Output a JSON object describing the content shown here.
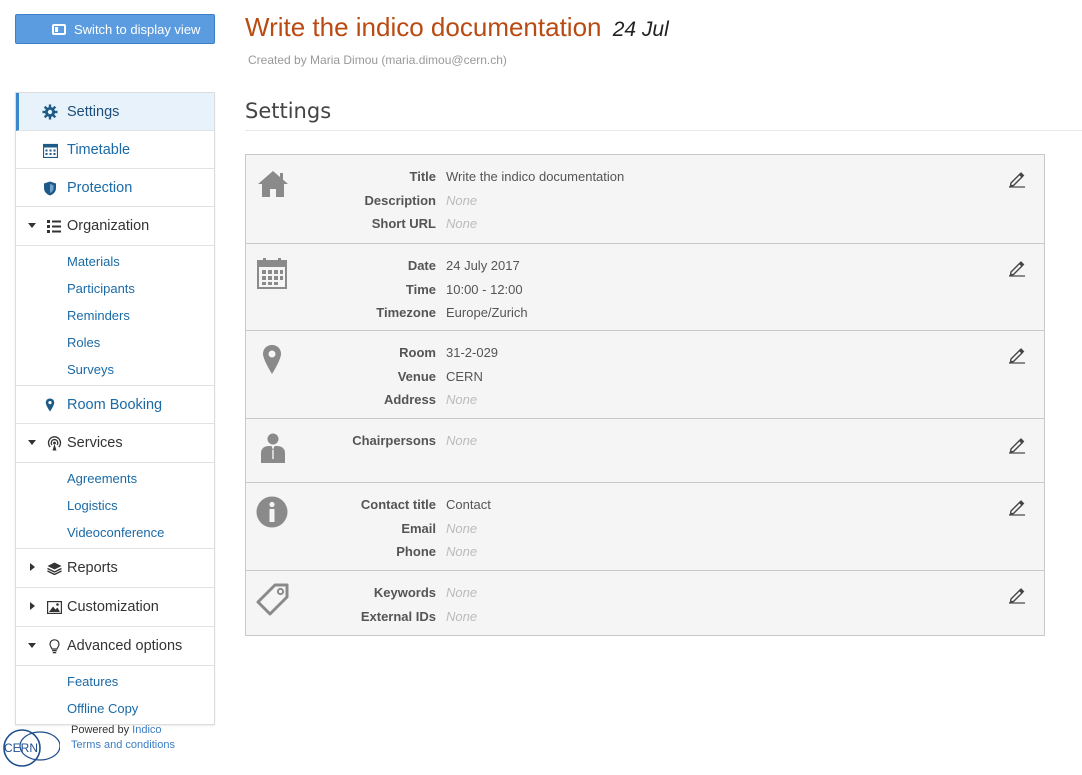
{
  "header": {
    "switch_button_label": "Switch to display view",
    "event_title": "Write the indico documentation",
    "event_date": "24 Jul",
    "created_by": "Created by Maria Dimou (maria.dimou@cern.ch)"
  },
  "sidebar": {
    "top_items": [
      {
        "label": "Settings",
        "icon": "gear-icon",
        "active": true
      },
      {
        "label": "Timetable",
        "icon": "calendar-icon"
      },
      {
        "label": "Protection",
        "icon": "shield-icon"
      }
    ],
    "organization": {
      "label": "Organization",
      "icon": "list-icon",
      "items": [
        "Materials",
        "Participants",
        "Reminders",
        "Roles",
        "Surveys"
      ]
    },
    "room_booking": {
      "label": "Room Booking",
      "icon": "map-pin-icon"
    },
    "services": {
      "label": "Services",
      "icon": "broadcast-icon",
      "items": [
        "Agreements",
        "Logistics",
        "Videoconference"
      ]
    },
    "reports": {
      "label": "Reports",
      "icon": "layers-icon"
    },
    "customization": {
      "label": "Customization",
      "icon": "image-icon"
    },
    "advanced": {
      "label": "Advanced options",
      "icon": "lightbulb-icon",
      "items": [
        "Features",
        "Offline Copy"
      ]
    }
  },
  "footer": {
    "powered_prefix": "Powered by",
    "powered_link": "Indico",
    "terms": "Terms and conditions",
    "logo_text": "CERN"
  },
  "main": {
    "section_title": "Settings",
    "groups": [
      {
        "icon": "home-icon",
        "rows": [
          {
            "key": "Title",
            "value": "Write the indico documentation",
            "none": false
          },
          {
            "key": "Description",
            "value": "None",
            "none": true
          },
          {
            "key": "Short URL",
            "value": "None",
            "none": true
          }
        ]
      },
      {
        "icon": "calendar-icon",
        "rows": [
          {
            "key": "Date",
            "value": "24 July 2017",
            "none": false
          },
          {
            "key": "Time",
            "value": "10:00 - 12:00",
            "none": false
          },
          {
            "key": "Timezone",
            "value": "Europe/Zurich",
            "none": false
          }
        ]
      },
      {
        "icon": "map-pin-icon",
        "rows": [
          {
            "key": "Room",
            "value": "31-2-029",
            "none": false
          },
          {
            "key": "Venue",
            "value": "CERN",
            "none": false
          },
          {
            "key": "Address",
            "value": "None",
            "none": true
          }
        ]
      },
      {
        "icon": "user-icon",
        "rows": [
          {
            "key": "Chairpersons",
            "value": "None",
            "none": true
          }
        ]
      },
      {
        "icon": "info-icon",
        "rows": [
          {
            "key": "Contact title",
            "value": "Contact",
            "none": false
          },
          {
            "key": "Email",
            "value": "None",
            "none": true
          },
          {
            "key": "Phone",
            "value": "None",
            "none": true
          }
        ]
      },
      {
        "icon": "tag-icon",
        "rows": [
          {
            "key": "Keywords",
            "value": "None",
            "none": true
          },
          {
            "key": "External IDs",
            "value": "None",
            "none": true
          }
        ]
      }
    ]
  },
  "colors": {
    "title": "#b94a12",
    "link": "#1a6aa6",
    "button": "#5b9be0",
    "icon_gray": "#888888"
  }
}
